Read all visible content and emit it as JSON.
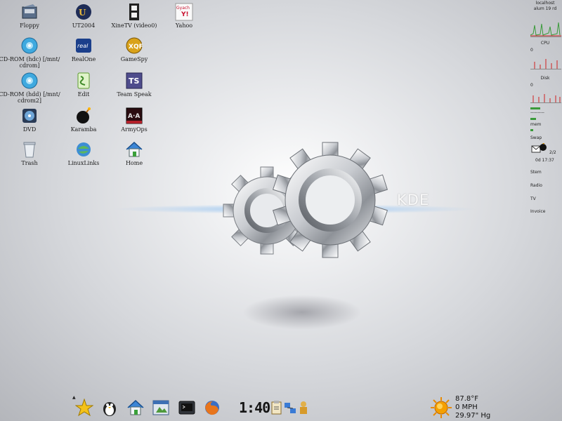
{
  "desktop": {
    "icons": [
      {
        "name": "floppy-icon",
        "label": "Floppy"
      },
      {
        "name": "cdrom-icon",
        "label": "CD-ROM (hdc) [/mnt/ cdrom]"
      },
      {
        "name": "cdrom-icon",
        "label": "CD-ROM (hdd) [/mnt/ cdrom2]"
      },
      {
        "name": "dvd-icon",
        "label": "DVD"
      },
      {
        "name": "trash-icon",
        "label": "Trash"
      },
      {
        "name": "ut2004-icon",
        "label": "UT2004"
      },
      {
        "name": "realone-icon",
        "label": "RealOne"
      },
      {
        "name": "edit-icon",
        "label": "Edit"
      },
      {
        "name": "karamba-icon",
        "label": "Karamba"
      },
      {
        "name": "linuxlinks-icon",
        "label": "LinuxLinks"
      },
      {
        "name": "xinetv-icon",
        "label": "XineTV (video0)"
      },
      {
        "name": "gamespy-icon",
        "label": "GameSpy"
      },
      {
        "name": "teamspeak-icon",
        "label": "Team Speak"
      },
      {
        "name": "armyops-icon",
        "label": "ArmyOps"
      },
      {
        "name": "home-icon",
        "label": "Home"
      },
      {
        "name": "yahoo-icon",
        "label": "Yahoo"
      }
    ],
    "wallpaper_text": "KDE"
  },
  "sysmon": {
    "host": "localhost",
    "uptime": "alum 19 rd",
    "cpu_label": "CPU",
    "cpu_min": "0",
    "disk_label": "Disk",
    "disk_min": "0",
    "mem_label": "mem",
    "swap_label": "Swap",
    "count": "2/2",
    "time": "0d 17:37",
    "items": [
      "Stem",
      "Radio",
      "TV",
      "Invoice"
    ]
  },
  "taskbar": {
    "clock": "1:40",
    "weather": {
      "temperature": "87.8°F",
      "wind": "0 MPH",
      "pressure": "29.97\" Hg"
    },
    "arrow": "▲"
  },
  "colors": {
    "accent": "#3a9a3a",
    "alert": "#d02020"
  }
}
